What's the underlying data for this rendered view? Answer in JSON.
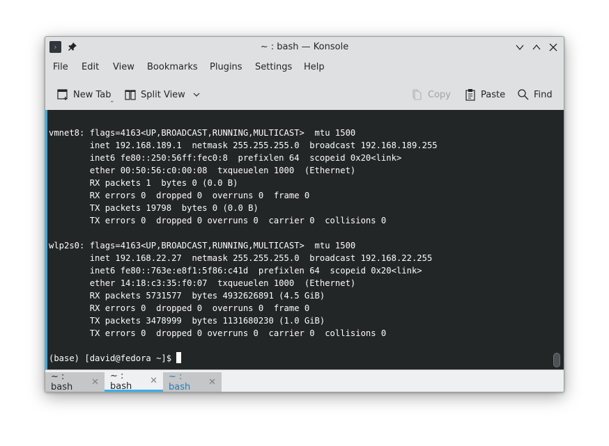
{
  "window": {
    "title": "~ : bash — Konsole",
    "app_icon": "terminal-icon",
    "controls": [
      "minimize-icon",
      "maximize-icon",
      "close-icon"
    ]
  },
  "menubar": {
    "items": [
      "File",
      "Edit",
      "View",
      "Bookmarks",
      "Plugins",
      "Settings",
      "Help"
    ]
  },
  "toolbar": {
    "new_tab": "New Tab",
    "split_view": "Split View",
    "copy": "Copy",
    "paste": "Paste",
    "find": "Find"
  },
  "terminal": {
    "lines": [
      "vmnet8: flags=4163<UP,BROADCAST,RUNNING,MULTICAST>  mtu 1500",
      "        inet 192.168.189.1  netmask 255.255.255.0  broadcast 192.168.189.255",
      "        inet6 fe80::250:56ff:fec0:8  prefixlen 64  scopeid 0x20<link>",
      "        ether 00:50:56:c0:00:08  txqueuelen 1000  (Ethernet)",
      "        RX packets 1  bytes 0 (0.0 B)",
      "        RX errors 0  dropped 0  overruns 0  frame 0",
      "        TX packets 19798  bytes 0 (0.0 B)",
      "        TX errors 0  dropped 0 overruns 0  carrier 0  collisions 0",
      "",
      "wlp2s0: flags=4163<UP,BROADCAST,RUNNING,MULTICAST>  mtu 1500",
      "        inet 192.168.22.27  netmask 255.255.255.0  broadcast 192.168.22.255",
      "        inet6 fe80::763e:e8f1:5f86:c41d  prefixlen 64  scopeid 0x20<link>",
      "        ether 14:18:c3:35:f0:07  txqueuelen 1000  (Ethernet)",
      "        RX packets 5731577  bytes 4932626891 (4.5 GiB)",
      "        RX errors 0  dropped 0  overruns 0  frame 0",
      "        TX packets 3478999  bytes 1131680230 (1.0 GiB)",
      "        TX errors 0  dropped 0 overruns 0  carrier 0  collisions 0",
      ""
    ],
    "prompt": "(base) [david@fedora ~]$ "
  },
  "tabs": [
    {
      "label": "~ : bash",
      "state": "normal"
    },
    {
      "label": "~ : bash",
      "state": "active"
    },
    {
      "label": "~ : bash",
      "state": "activity"
    }
  ],
  "colors": {
    "accent": "#3daee9",
    "terminal_bg": "#232627",
    "terminal_fg": "#fcfcfc"
  }
}
